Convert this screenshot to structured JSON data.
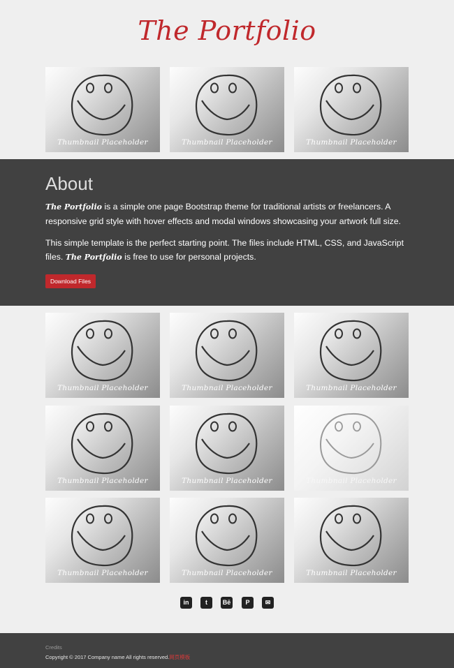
{
  "header": {
    "title": "The Portfolio"
  },
  "thumbnail_caption": "Thumbnail Placeholder",
  "about": {
    "heading": "About",
    "p1_brand": "The Portfolio",
    "p1_text": " is a simple one page Bootstrap theme for traditional artists or freelancers. A responsive grid style with hover effects and modal windows showcasing your artwork full size.",
    "p2_text": "This simple template is the perfect starting point. The files include HTML, CSS, and JavaScript files. ",
    "p2_brand": "The Portfolio",
    "p2_tail": " is free to use for personal projects.",
    "button_label": "Download Files"
  },
  "social": [
    {
      "name": "linkedin-icon",
      "glyph": "in"
    },
    {
      "name": "twitter-icon",
      "glyph": "t"
    },
    {
      "name": "behance-icon",
      "glyph": "Bē"
    },
    {
      "name": "pinterest-icon",
      "glyph": "P"
    },
    {
      "name": "email-icon",
      "glyph": "✉"
    }
  ],
  "footer": {
    "credits": "Credits",
    "copyright": "Copyright © 2017 Company name All rights reserved.",
    "link_text": "网页模板"
  },
  "colors": {
    "accent": "#c0282c",
    "dark_band": "#414141",
    "page_bg": "#efefef"
  }
}
